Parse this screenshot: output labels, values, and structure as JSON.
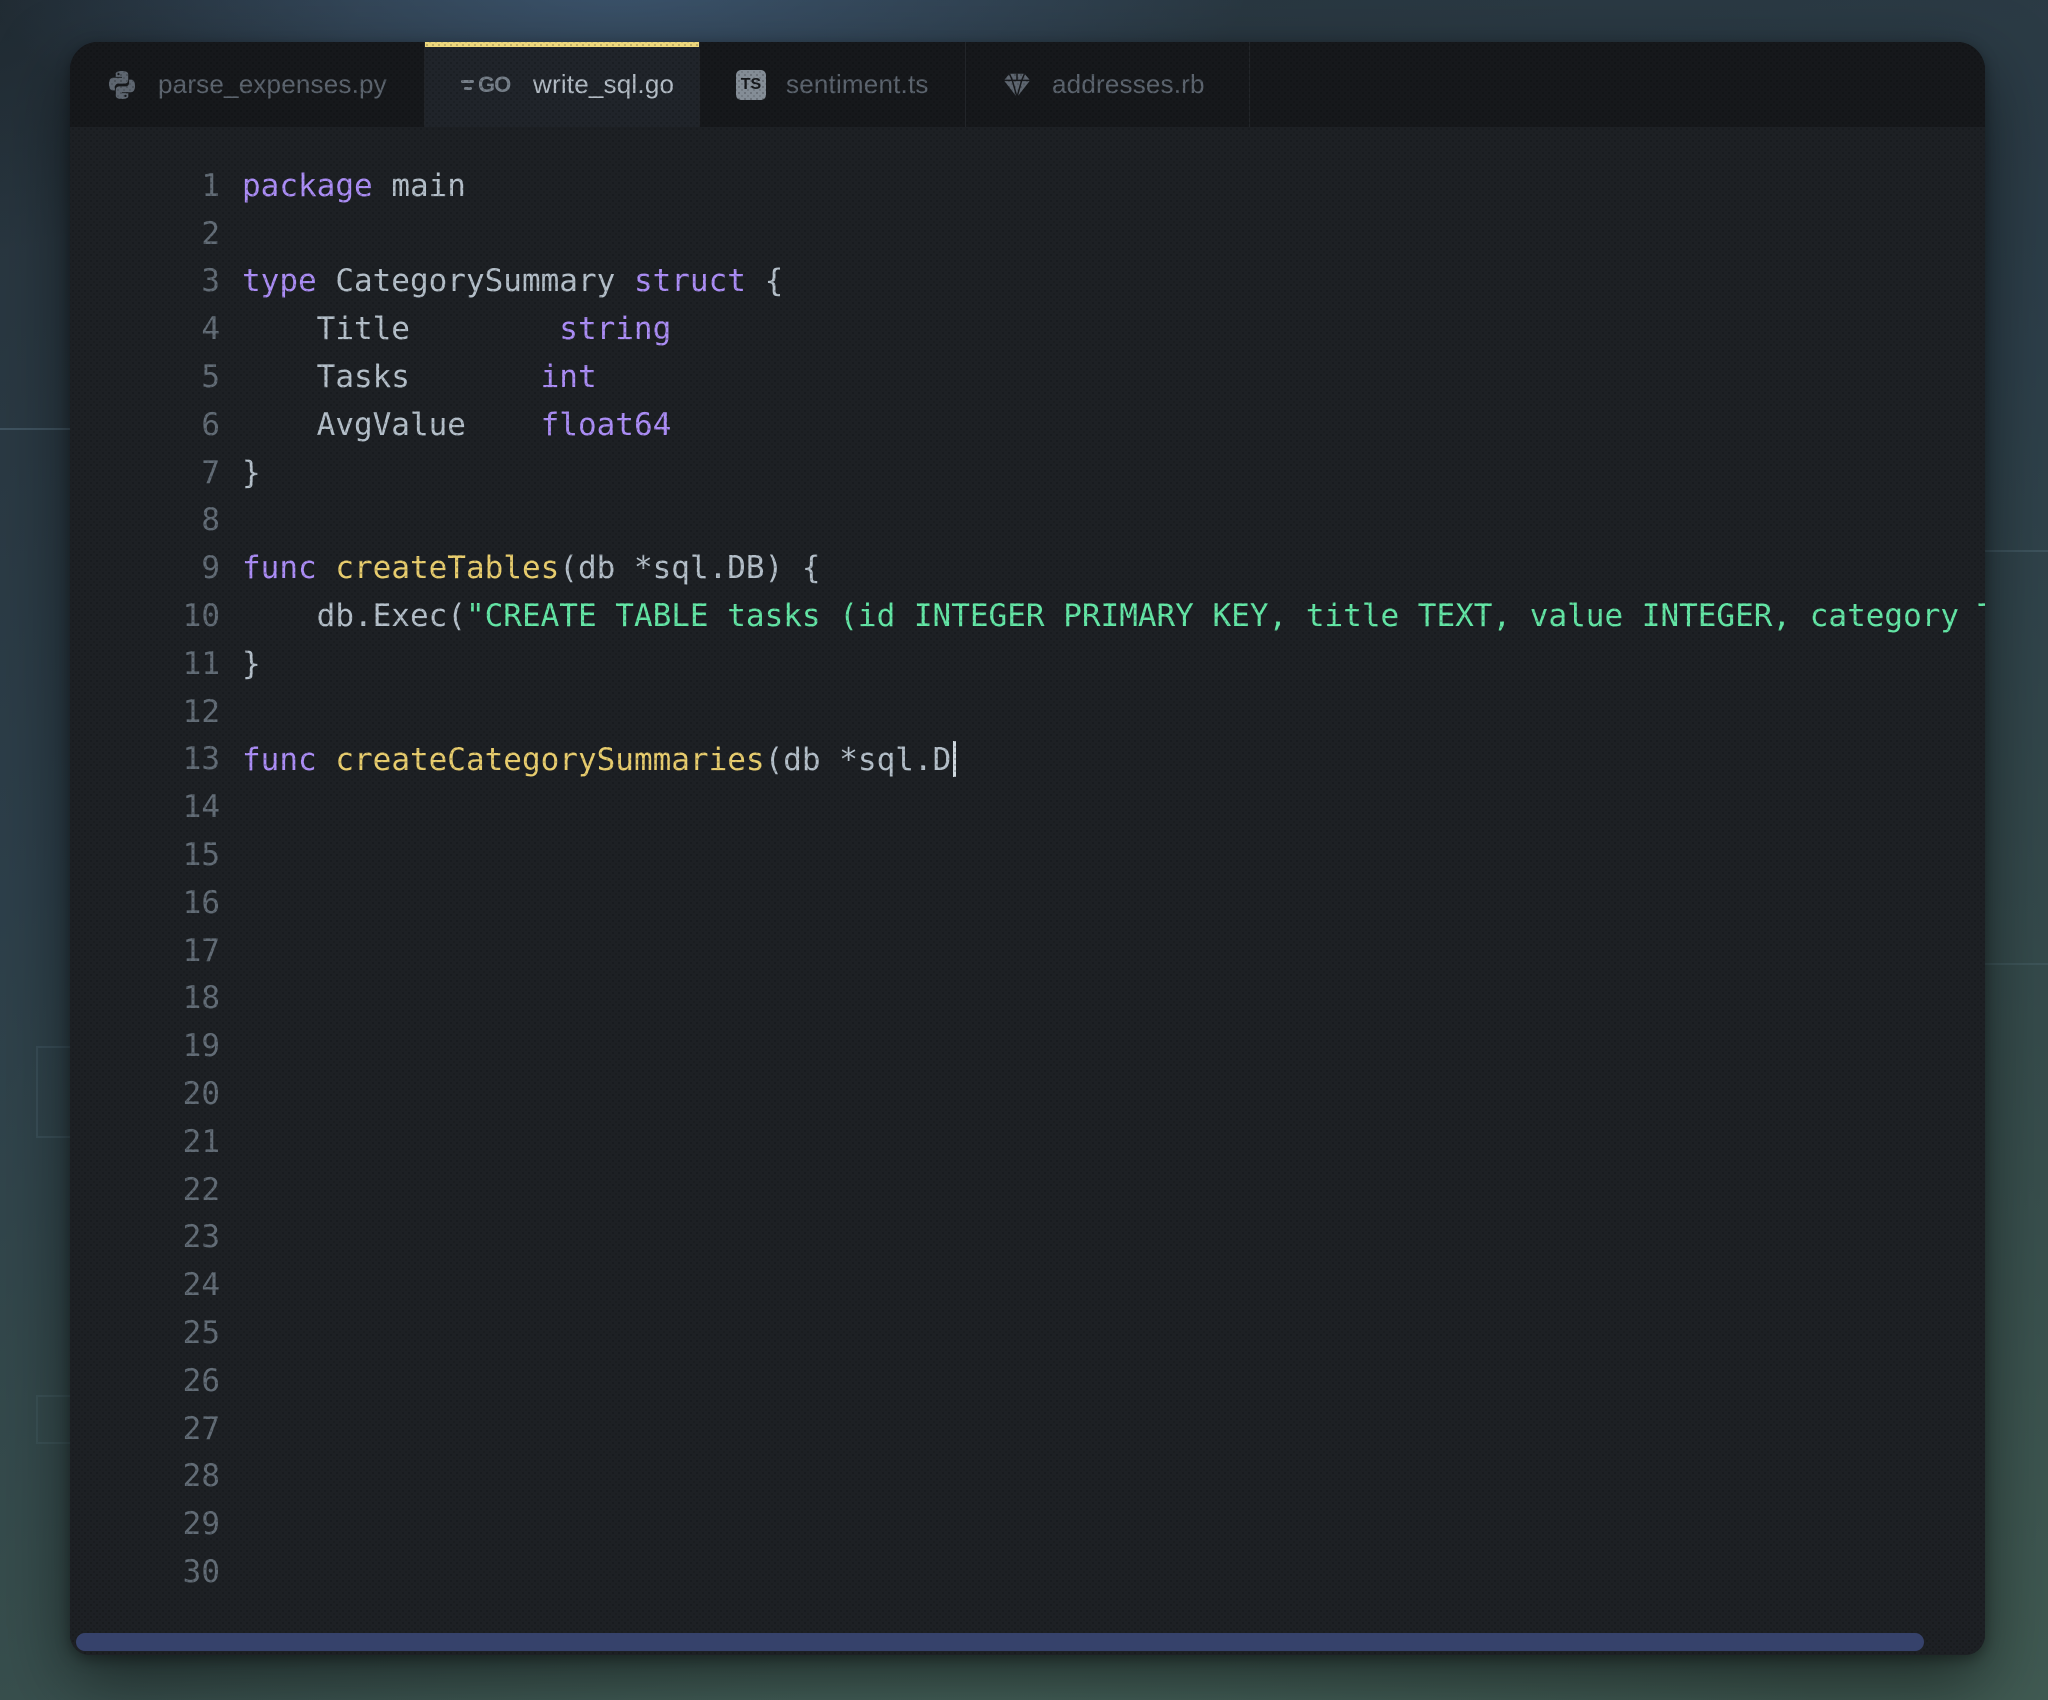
{
  "window": {
    "tabs": [
      {
        "label": "parse_expenses.py",
        "icon": "python-icon",
        "active": false
      },
      {
        "label": "write_sql.go",
        "icon": "go-icon",
        "badge": "GO",
        "active": true
      },
      {
        "label": "sentiment.ts",
        "icon": "typescript-icon",
        "badge": "TS",
        "active": false
      },
      {
        "label": "addresses.rb",
        "icon": "ruby-icon",
        "active": false
      }
    ]
  },
  "editor": {
    "language": "Go",
    "total_lines": 30,
    "cursor_line": 13,
    "lines": [
      {
        "n": 1,
        "tokens": [
          {
            "c": "kw",
            "t": "package"
          },
          {
            "c": "pl",
            "t": " main"
          }
        ]
      },
      {
        "n": 2,
        "tokens": []
      },
      {
        "n": 3,
        "tokens": [
          {
            "c": "kw",
            "t": "type"
          },
          {
            "c": "pl",
            "t": " CategorySummary "
          },
          {
            "c": "kw",
            "t": "struct"
          },
          {
            "c": "pl",
            "t": " {"
          }
        ]
      },
      {
        "n": 4,
        "tokens": [
          {
            "c": "pl",
            "t": "    Title        "
          },
          {
            "c": "ty",
            "t": "string"
          }
        ]
      },
      {
        "n": 5,
        "tokens": [
          {
            "c": "pl",
            "t": "    Tasks       "
          },
          {
            "c": "ty",
            "t": "int"
          }
        ]
      },
      {
        "n": 6,
        "tokens": [
          {
            "c": "pl",
            "t": "    AvgValue    "
          },
          {
            "c": "ty",
            "t": "float64"
          }
        ]
      },
      {
        "n": 7,
        "tokens": [
          {
            "c": "pl",
            "t": "}"
          }
        ]
      },
      {
        "n": 8,
        "tokens": []
      },
      {
        "n": 9,
        "tokens": [
          {
            "c": "kw",
            "t": "func"
          },
          {
            "c": "pl",
            "t": " "
          },
          {
            "c": "fn",
            "t": "createTables"
          },
          {
            "c": "pl",
            "t": "(db *sql.DB) {"
          }
        ]
      },
      {
        "n": 10,
        "tokens": [
          {
            "c": "pl",
            "t": "    db.Exec("
          },
          {
            "c": "str",
            "t": "\"CREATE TABLE tasks (id INTEGER PRIMARY KEY, title TEXT, value INTEGER, category TEXT"
          }
        ]
      },
      {
        "n": 11,
        "tokens": [
          {
            "c": "pl",
            "t": "}"
          }
        ]
      },
      {
        "n": 12,
        "tokens": []
      },
      {
        "n": 13,
        "tokens": [
          {
            "c": "kw",
            "t": "func"
          },
          {
            "c": "pl",
            "t": " "
          },
          {
            "c": "fn",
            "t": "createCategorySummaries"
          },
          {
            "c": "pl",
            "t": "(db *sql.D"
          }
        ]
      },
      {
        "n": 14,
        "tokens": []
      },
      {
        "n": 15,
        "tokens": []
      },
      {
        "n": 16,
        "tokens": []
      },
      {
        "n": 17,
        "tokens": []
      },
      {
        "n": 18,
        "tokens": []
      },
      {
        "n": 19,
        "tokens": []
      },
      {
        "n": 20,
        "tokens": []
      },
      {
        "n": 21,
        "tokens": []
      },
      {
        "n": 22,
        "tokens": []
      },
      {
        "n": 23,
        "tokens": []
      },
      {
        "n": 24,
        "tokens": []
      },
      {
        "n": 25,
        "tokens": []
      },
      {
        "n": 26,
        "tokens": []
      },
      {
        "n": 27,
        "tokens": []
      },
      {
        "n": 28,
        "tokens": []
      },
      {
        "n": 29,
        "tokens": []
      },
      {
        "n": 30,
        "tokens": []
      }
    ]
  },
  "colors": {
    "accent": "#eed87d",
    "kw": "#ab8df5",
    "ty": "#ab8df5",
    "fn": "#e8cd6e",
    "str": "#63e5a5",
    "pl": "#b4bfc9",
    "sb": "#36426b",
    "bg-editor": "#1d2024",
    "bg-tabbar": "#16181b"
  }
}
